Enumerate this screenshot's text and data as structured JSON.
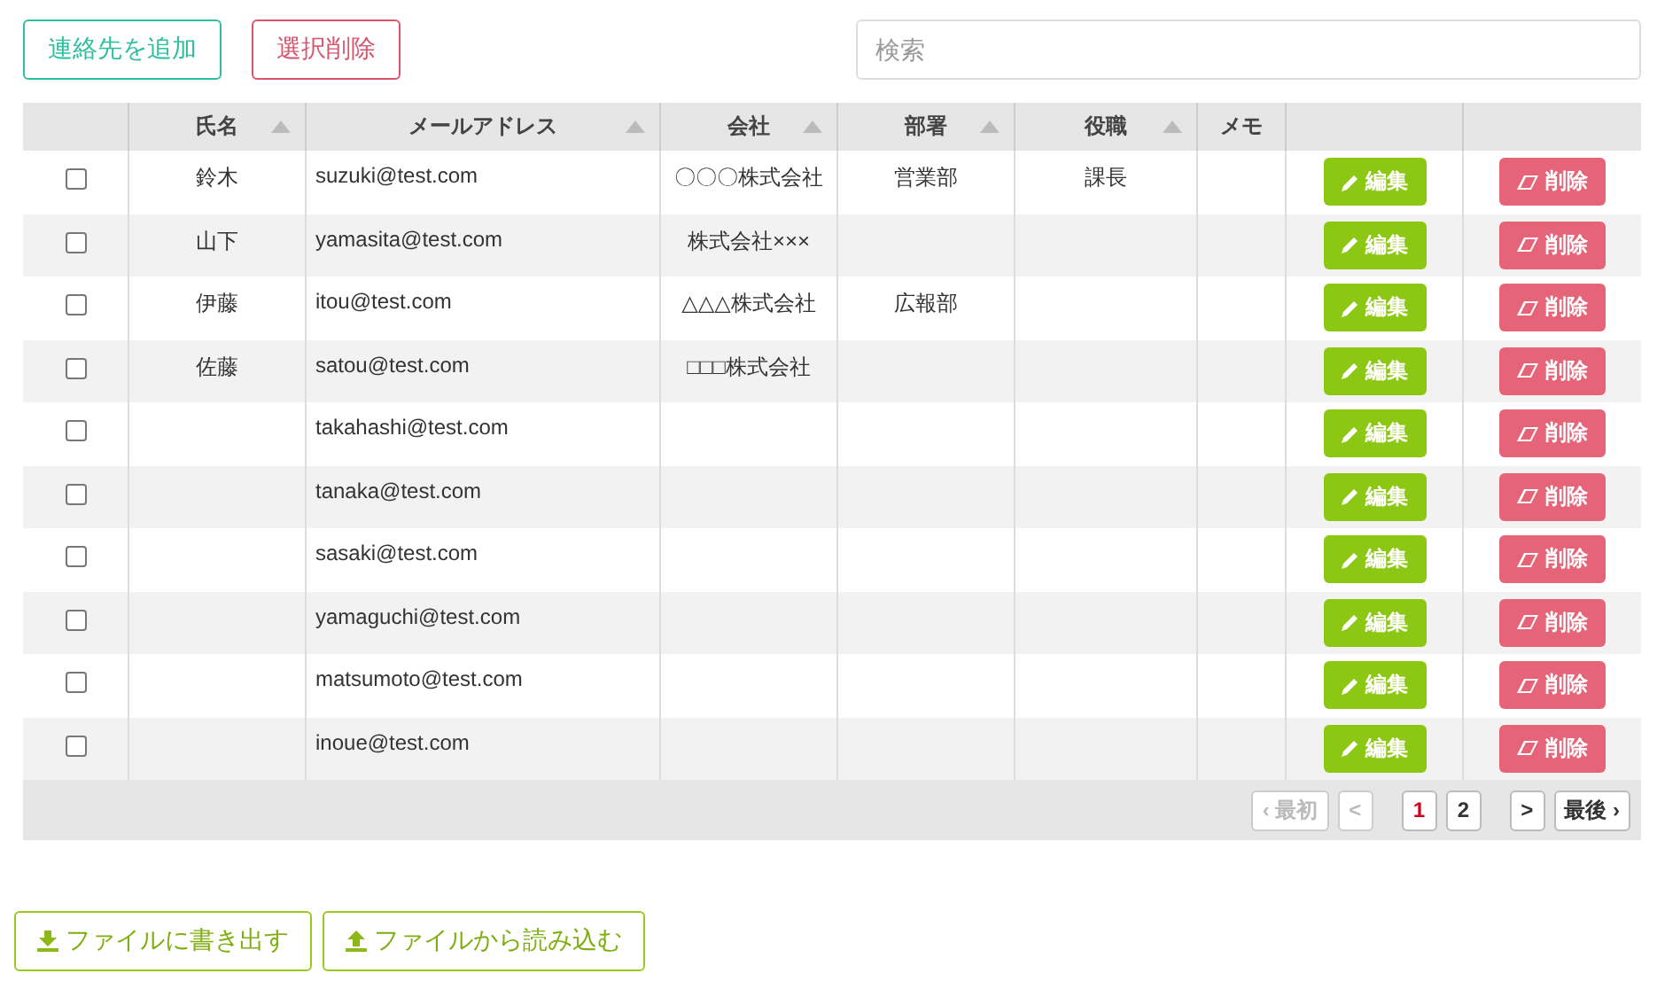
{
  "toolbar": {
    "add_button": "連絡先を追加",
    "delete_selected_button": "選択削除",
    "search": {
      "placeholder": "検索"
    }
  },
  "table": {
    "columns": [
      {
        "sortable": false
      },
      {
        "label": "氏名",
        "sortable": true
      },
      {
        "label": "メールアドレス",
        "sortable": true
      },
      {
        "label": "会社",
        "sortable": true
      },
      {
        "label": "部署",
        "sortable": true
      },
      {
        "label": "役職",
        "sortable": true
      },
      {
        "label": "メモ",
        "sortable": false
      },
      {
        "sortable": false
      },
      {
        "sortable": false
      }
    ],
    "rows": [
      {
        "checked": false,
        "name": "鈴木",
        "email": "suzuki@test.com",
        "company": "〇〇〇株式会社",
        "department": "営業部",
        "title": "課長",
        "edit": "編集",
        "delete": "削除"
      },
      {
        "checked": false,
        "name": "山下",
        "email": "yamasita@test.com",
        "company": "株式会社×××",
        "department": "",
        "title": "",
        "edit": "編集",
        "delete": "削除"
      },
      {
        "checked": false,
        "name": "伊藤",
        "email": "itou@test.com",
        "company": "△△△株式会社",
        "department": "広報部",
        "title": "",
        "edit": "編集",
        "delete": "削除"
      },
      {
        "checked": false,
        "name": "佐藤",
        "email": "satou@test.com",
        "company": "□□□株式会社",
        "department": "",
        "title": "",
        "edit": "編集",
        "delete": "削除"
      },
      {
        "checked": false,
        "name": "",
        "email": "takahashi@test.com",
        "company": "",
        "department": "",
        "title": "",
        "edit": "編集",
        "delete": "削除"
      },
      {
        "checked": false,
        "name": "",
        "email": "tanaka@test.com",
        "company": "",
        "department": "",
        "title": "",
        "edit": "編集",
        "delete": "削除"
      },
      {
        "checked": false,
        "name": "",
        "email": "sasaki@test.com",
        "company": "",
        "department": "",
        "title": "",
        "edit": "編集",
        "delete": "削除"
      },
      {
        "checked": false,
        "name": "",
        "email": "yamaguchi@test.com",
        "company": "",
        "department": "",
        "title": "",
        "edit": "編集",
        "delete": "削除"
      },
      {
        "checked": false,
        "name": "",
        "email": "matsumoto@test.com",
        "company": "",
        "department": "",
        "title": "",
        "edit": "編集",
        "delete": "削除"
      },
      {
        "checked": false,
        "name": "",
        "email": "inoue@test.com",
        "company": "",
        "department": "",
        "title": "",
        "edit": "編集",
        "delete": "削除"
      }
    ],
    "pagination": [
      {
        "label": "‹ 最初",
        "disabled": true,
        "selected": false,
        "kind": "nav"
      },
      {
        "label": "<",
        "disabled": true,
        "selected": false,
        "kind": "nav"
      },
      {
        "label": "1",
        "disabled": false,
        "selected": true,
        "kind": "page"
      },
      {
        "label": "2",
        "disabled": false,
        "selected": false,
        "kind": "page"
      },
      {
        "label": ">",
        "disabled": false,
        "selected": false,
        "kind": "nav"
      },
      {
        "label": "最後 ›",
        "disabled": false,
        "selected": false,
        "kind": "nav"
      }
    ]
  },
  "file_buttons": [
    {
      "kind": "export",
      "label": "ファイルに書き出す"
    },
    {
      "kind": "import",
      "label": "ファイルから読み込む"
    }
  ]
}
